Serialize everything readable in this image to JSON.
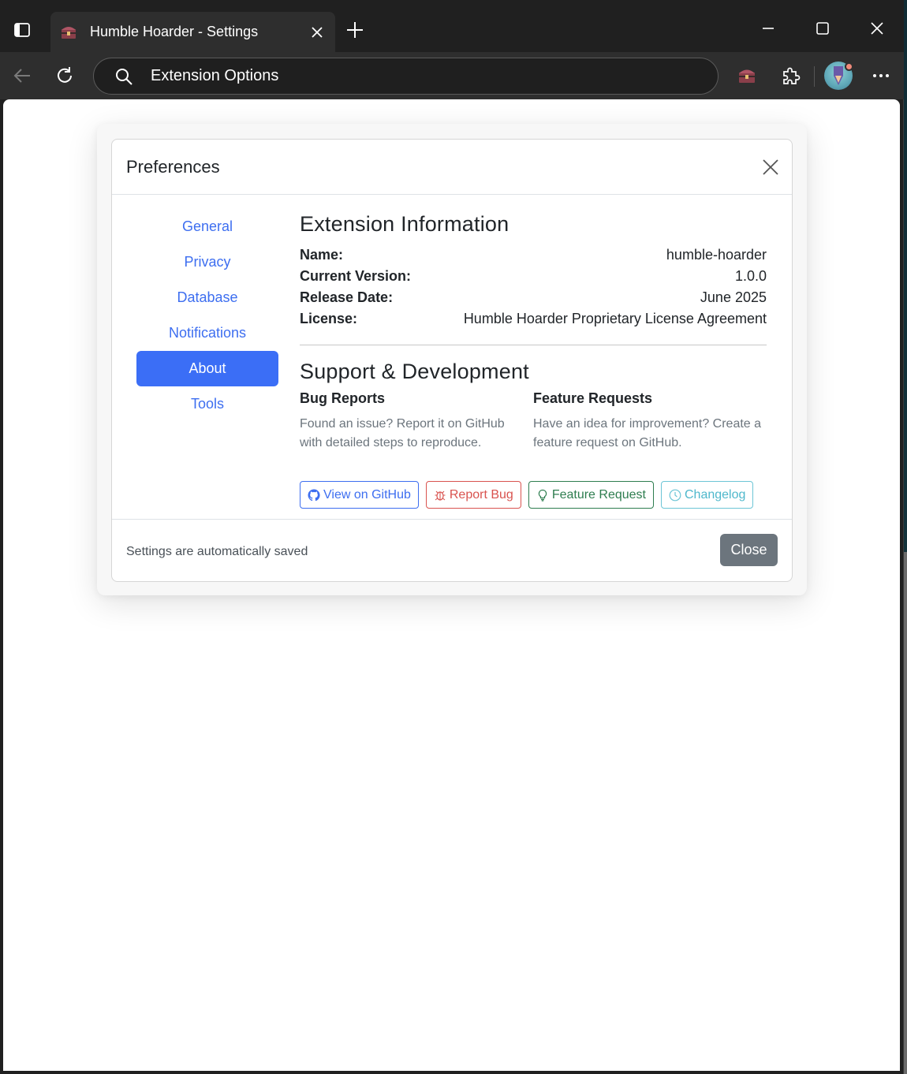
{
  "browser": {
    "tab_title": "Humble Hoarder - Settings",
    "address": "Extension Options"
  },
  "modal": {
    "title": "Preferences",
    "nav": [
      {
        "label": "General"
      },
      {
        "label": "Privacy"
      },
      {
        "label": "Database"
      },
      {
        "label": "Notifications"
      },
      {
        "label": "About",
        "active": true
      },
      {
        "label": "Tools"
      }
    ],
    "info": {
      "heading": "Extension Information",
      "rows": [
        {
          "key": "Name:",
          "value": "humble-hoarder"
        },
        {
          "key": "Current Version:",
          "value": "1.0.0"
        },
        {
          "key": "Release Date:",
          "value": "June 2025"
        },
        {
          "key": "License:",
          "value": "Humble Hoarder Proprietary License Agreement"
        }
      ]
    },
    "support": {
      "heading": "Support & Development",
      "bug_title": "Bug Reports",
      "bug_text": "Found an issue? Report it on GitHub with detailed steps to reproduce.",
      "feature_title": "Feature Requests",
      "feature_text": "Have an idea for improvement? Create a feature request on GitHub."
    },
    "buttons": {
      "github": "View on GitHub",
      "report_bug": "Report Bug",
      "feature_request": "Feature Request",
      "changelog": "Changelog"
    },
    "footer": {
      "status": "Settings are automatically saved",
      "close": "Close"
    }
  },
  "colors": {
    "accent": "#3b6ef6",
    "danger": "#d9534f",
    "success": "#2e7d4f",
    "info": "#4fb8cc",
    "secondary": "#6c757d"
  }
}
